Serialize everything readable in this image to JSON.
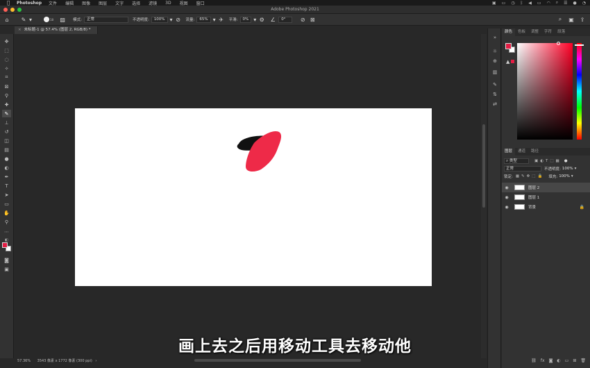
{
  "menubar": {
    "app_name": "Photoshop",
    "items": [
      "文件",
      "编辑",
      "图像",
      "图层",
      "文字",
      "选择",
      "滤镜",
      "3D",
      "视图",
      "窗口"
    ]
  },
  "window": {
    "title": "Adobe Photoshop 2021"
  },
  "options_bar": {
    "mode_label": "模式:",
    "mode_value": "正常",
    "opacity_label": "不透明度:",
    "opacity_value": "100%",
    "flow_label": "流量:",
    "flow_value": "65%",
    "smoothing_label": "平滑:",
    "smoothing_value": "0%",
    "angle_value": "0°",
    "brush_size": "18"
  },
  "document_tab": {
    "title": "未标题-1 @ 57.4% (图层 2, RGB/8) *"
  },
  "status_bar": {
    "zoom": "57.36%",
    "doc_info": "3543 像素 x 1772 像素 (300 ppi)"
  },
  "color_panel": {
    "tabs": [
      "颜色",
      "色板",
      "调整",
      "字符",
      "段落"
    ],
    "active_tab": "颜色",
    "foreground_color": "#e31d44",
    "background_color": "#ffffff"
  },
  "layers_panel": {
    "tabs": [
      "图层",
      "通道",
      "路径"
    ],
    "active_tab": "图层",
    "filter_label": "类型",
    "blend_mode": "正常",
    "opacity_label": "不透明度:",
    "opacity_value": "100%",
    "lock_label": "锁定:",
    "fill_label": "填充:",
    "fill_value": "100%",
    "layers": [
      {
        "name": "图层 2",
        "selected": true
      },
      {
        "name": "图层 1",
        "selected": false
      },
      {
        "name": "背景",
        "selected": false,
        "locked": true
      }
    ]
  },
  "subtitle": "画上去之后用移动工具去移动他",
  "colors": {
    "accent_red": "#e31d44",
    "stroke_black": "#111111"
  }
}
